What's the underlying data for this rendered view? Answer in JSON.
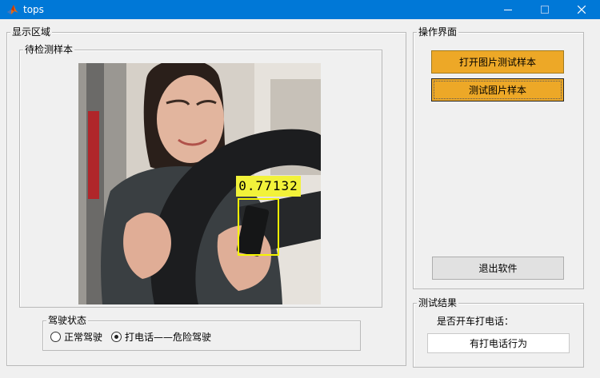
{
  "window": {
    "title": "tops",
    "controls": [
      "minimize-icon",
      "maximize-icon",
      "close-icon"
    ]
  },
  "display_panel": {
    "title": "显示区域",
    "sample_panel": {
      "title": "待检测样本",
      "detection": {
        "score_label": "0.77132",
        "box_color": "#f5f500"
      }
    },
    "drive_status": {
      "title": "驾驶状态",
      "options": [
        {
          "label": "正常驾驶",
          "selected": false
        },
        {
          "label": "打电话——危险驾驶",
          "selected": true
        }
      ]
    }
  },
  "operations": {
    "title": "操作界面",
    "open_button": "打开图片测试样本",
    "test_button": "测试图片样本",
    "exit_button": "退出软件",
    "accent_color": "#eda827"
  },
  "result": {
    "title": "测试结果",
    "question": "是否开车打电话：",
    "value": "有打电话行为"
  }
}
